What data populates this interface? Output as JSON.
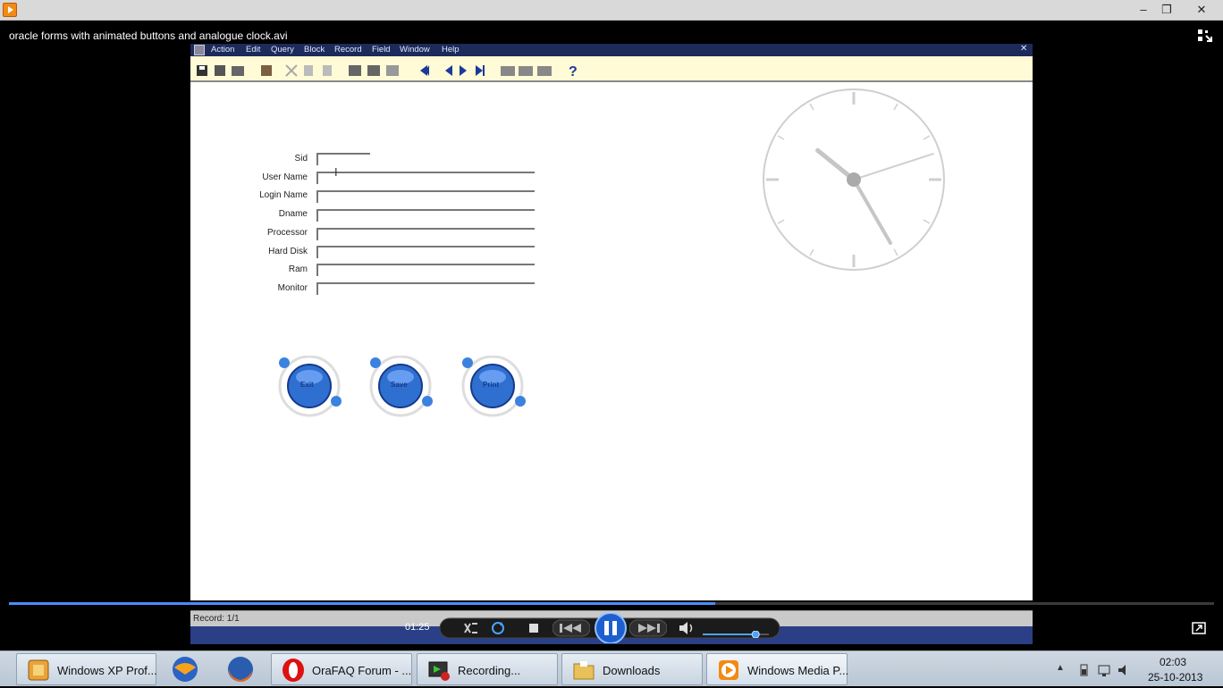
{
  "window": {
    "min_glyph": "–",
    "max_glyph": "❐",
    "close_glyph": "✕"
  },
  "player": {
    "video_title": "oracle forms with animated buttons and analogue clock.avi",
    "time_elapsed": "01:25",
    "progress": 0.586,
    "volume": 0.8
  },
  "video": {
    "menu": [
      "Action",
      "Edit",
      "Query",
      "Block",
      "Record",
      "Field",
      "Window",
      "Help"
    ],
    "form": {
      "labels": [
        "Sid",
        "User Name",
        "Login Name",
        "Dname",
        "Processor",
        "Hard Disk",
        "Ram",
        "Monitor"
      ]
    },
    "buttons": [
      "Exit",
      "Save",
      "Print"
    ],
    "status": "Record: 1/1",
    "clock": {
      "hour": 10.3,
      "minute": 25,
      "second": 12
    }
  },
  "taskbar": {
    "items": [
      {
        "label": "Windows XP Prof...",
        "icon": "virtualbox-icon"
      },
      {
        "label": "OraFAQ Forum - ...",
        "icon": "opera-icon"
      },
      {
        "label": "Recording...",
        "icon": "recorder-icon"
      },
      {
        "label": "Downloads",
        "icon": "folder-icon"
      },
      {
        "label": "Windows Media P...",
        "icon": "media-player-icon"
      }
    ],
    "pinned": [
      "thunderbird-icon",
      "firefox-icon"
    ],
    "clock": {
      "time": "02:03",
      "date": "25-10-2013"
    }
  },
  "colors": {
    "accent": "#4a8cff",
    "taskbar": "#c4d0dc",
    "orb": "#2f6fd0"
  }
}
